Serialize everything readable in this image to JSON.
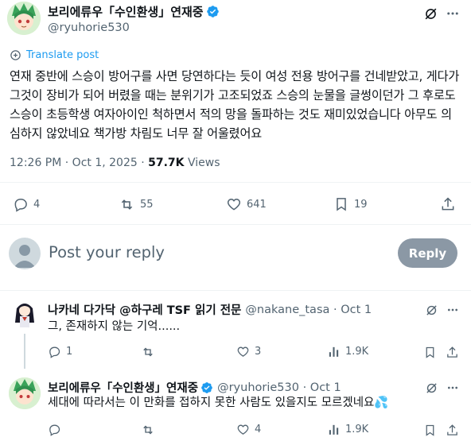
{
  "post": {
    "author_name": "보리에류우「수인환생」연재중",
    "author_handle": "@ryuhorie530",
    "translate_label": "Translate post",
    "text": "연재 중반에 스승이 방어구를 사면 당연하다는 듯이 여성 전용 방어구를 건네받았고, 게다가 그것이 장비가 되어 버렸을 때는 분위기가 고조되었죠 스승의 눈물을 글썽이던가 그 후로도 스승이 초등학생 여자아이인 척하면서 적의 망을 돌파하는 것도 재미있었습니다 아무도 의심하지 않았네요 책가방 차림도 너무 잘 어울렸어요",
    "time": "12:26 PM · Oct 1, 2025 · ",
    "views_count": "57.7K",
    "views_label": " Views",
    "stats": {
      "replies": "4",
      "reposts": "55",
      "likes": "641",
      "bookmarks": "19"
    }
  },
  "compose": {
    "placeholder": "Post your reply",
    "button_label": "Reply"
  },
  "replies": [
    {
      "author_name": "나카네 다가닥 @하구레 TSF 읽기 전문",
      "author_handle": "@nakane_tasa · Oct 1",
      "text": "그, 존재하지 않는 기억......",
      "stats": {
        "replies": "1",
        "reposts": "",
        "likes": "3",
        "views": "1.9K"
      }
    },
    {
      "author_name": "보리에류우「수인환생」연재중",
      "author_handle": "@ryuhorie530 · Oct 1",
      "text": "세대에 따라서는 이 만화를 접하지 못한 사람도 있을지도 모르겠네요",
      "emoji": "💦",
      "stats": {
        "replies": "",
        "reposts": "",
        "likes": "4",
        "views": "1.9K"
      }
    }
  ],
  "colors": {
    "accent": "#1d9bf0",
    "text": "#0f1419",
    "muted": "#536471",
    "divider": "#eff3f4",
    "reply_button": "#8b98a5"
  },
  "icons": [
    "grok-icon",
    "more-icon",
    "translate-icon",
    "reply-icon",
    "repost-icon",
    "like-icon",
    "bookmark-icon",
    "share-icon",
    "views-icon",
    "verified-badge-icon"
  ]
}
